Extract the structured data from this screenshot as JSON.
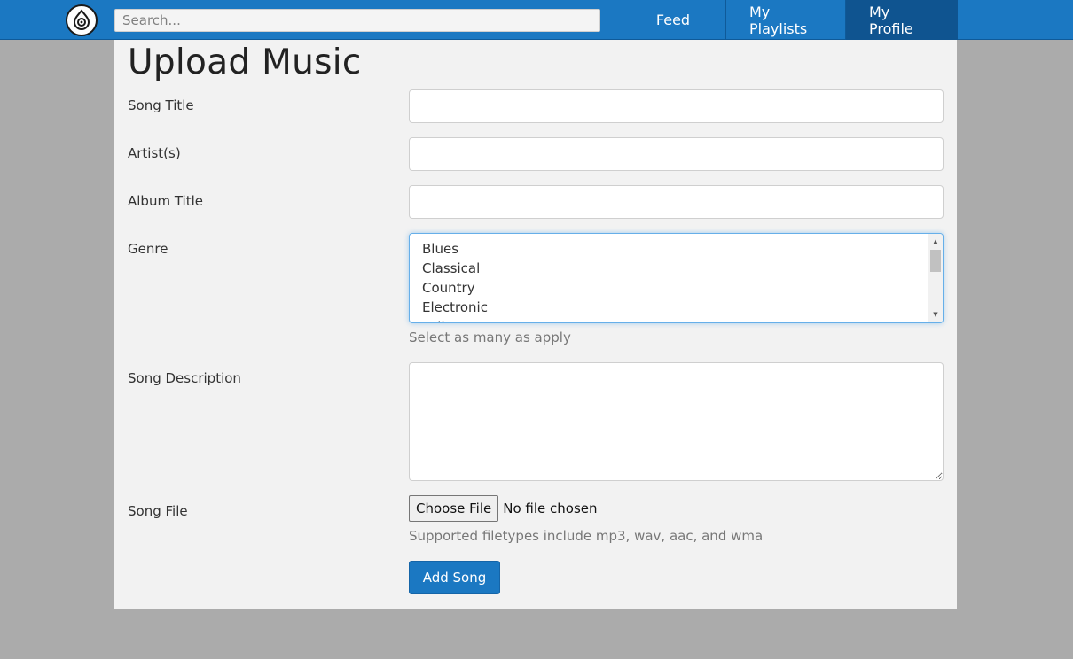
{
  "header": {
    "logo_icon": "music-drop-logo-icon",
    "search_placeholder": "Search...",
    "nav": {
      "feed": "Feed",
      "playlists": "My Playlists",
      "profile": "My Profile"
    },
    "active_nav": "My Profile",
    "accent_color": "#1b78c2"
  },
  "form": {
    "title": "Upload Music",
    "song_title_label": "Song Title",
    "song_title_value": "",
    "artists_label": "Artist(s)",
    "artists_value": "",
    "album_label": "Album Title",
    "album_value": "",
    "genre_label": "Genre",
    "genre_options": [
      "Blues",
      "Classical",
      "Country",
      "Electronic",
      "Folk"
    ],
    "genre_help": "Select as many as apply",
    "description_label": "Song Description",
    "description_value": "",
    "file_label": "Song File",
    "choose_file_label": "Choose File",
    "file_status": "No file chosen",
    "file_help": "Supported filetypes include mp3, wav, aac, and wma",
    "submit_label": "Add Song"
  }
}
